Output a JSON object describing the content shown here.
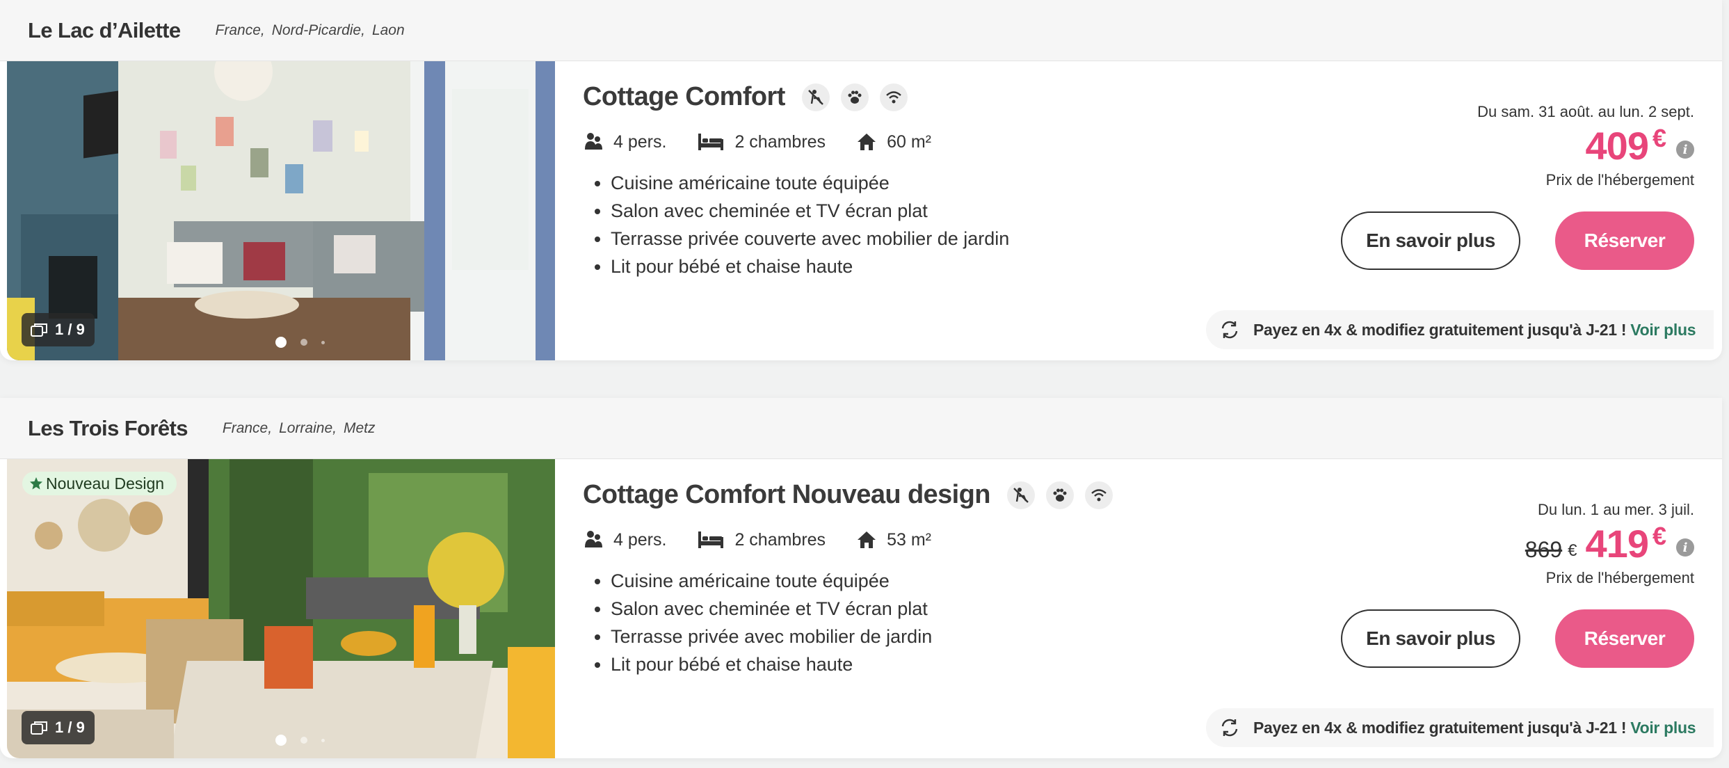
{
  "listings": [
    {
      "site_name": "Le Lac d’Ailette",
      "location": [
        "France",
        "Nord-Picardie",
        "Laon"
      ],
      "badge": "",
      "photo_counter": "1 / 9",
      "title": "Cottage Comfort",
      "feature_icons": [
        "no-smoking-icon",
        "pet-paw-icon",
        "wifi-icon"
      ],
      "specs": {
        "persons": "4 pers.",
        "bedrooms": "2 chambres",
        "area": "60 m²"
      },
      "amenities": [
        "Cuisine américaine toute équipée",
        "Salon avec cheminée et TV écran plat",
        "Terrasse privée couverte avec mobilier de jardin",
        "Lit pour bébé et chaise haute"
      ],
      "dates": "Du sam. 31 août. au lun. 2 sept.",
      "old_price": "",
      "old_currency": "",
      "price": "409",
      "currency": "€",
      "price_label": "Prix de l'hébergement",
      "more_label": "En savoir plus",
      "book_label": "Réserver",
      "pay_text": "Payez en 4x & modifiez gratuitement jusqu'à J-21 !",
      "pay_link": "Voir plus"
    },
    {
      "site_name": "Les Trois Forêts",
      "location": [
        "France",
        "Lorraine",
        "Metz"
      ],
      "badge": "Nouveau Design",
      "photo_counter": "1 / 9",
      "title": "Cottage Comfort Nouveau design",
      "feature_icons": [
        "no-smoking-icon",
        "pet-paw-icon",
        "wifi-icon"
      ],
      "specs": {
        "persons": "4 pers.",
        "bedrooms": "2 chambres",
        "area": "53 m²"
      },
      "amenities": [
        "Cuisine américaine toute équipée",
        "Salon avec cheminée et TV écran plat",
        "Terrasse privée avec mobilier de jardin",
        "Lit pour bébé et chaise haute"
      ],
      "dates": "Du lun. 1 au mer. 3 juil.",
      "old_price": "869",
      "old_currency": "€",
      "price": "419",
      "currency": "€",
      "price_label": "Prix de l'hébergement",
      "more_label": "En savoir plus",
      "book_label": "Réserver",
      "pay_text": "Payez en 4x & modifiez gratuitement jusqu'à J-21 !",
      "pay_link": "Voir plus"
    }
  ],
  "colors": {
    "accent": "#e8457a",
    "button": "#ea5a89",
    "link": "#2c7a61",
    "badge_bg": "#e3f6e2"
  }
}
